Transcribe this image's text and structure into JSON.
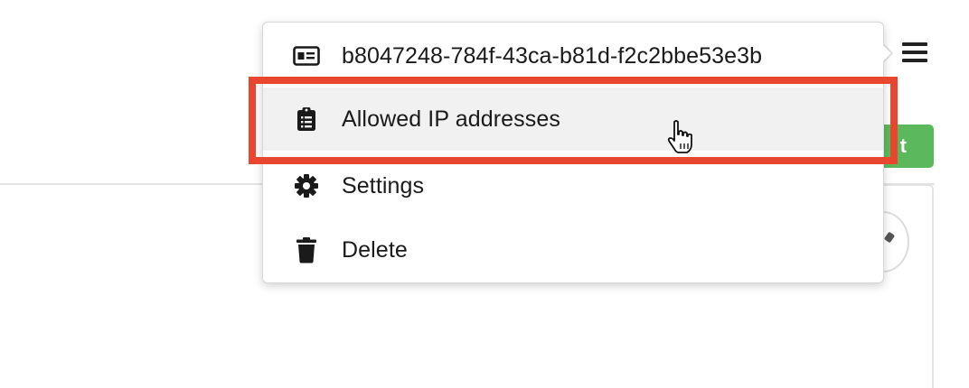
{
  "menu": {
    "items": [
      {
        "label": "b8047248-784f-43ca-b81d-f2c2bbe53e3b",
        "icon": "id-card-icon"
      },
      {
        "label": "Allowed IP addresses",
        "icon": "clipboard-list-icon"
      },
      {
        "label": "Settings",
        "icon": "gear-icon"
      },
      {
        "label": "Delete",
        "icon": "trash-icon"
      }
    ],
    "hovered_index": 1
  },
  "background": {
    "green_button_label": "t"
  },
  "colors": {
    "highlight": "#e8462f",
    "green_button": "#5cb85c",
    "hover_bg": "#f1f1f1"
  }
}
